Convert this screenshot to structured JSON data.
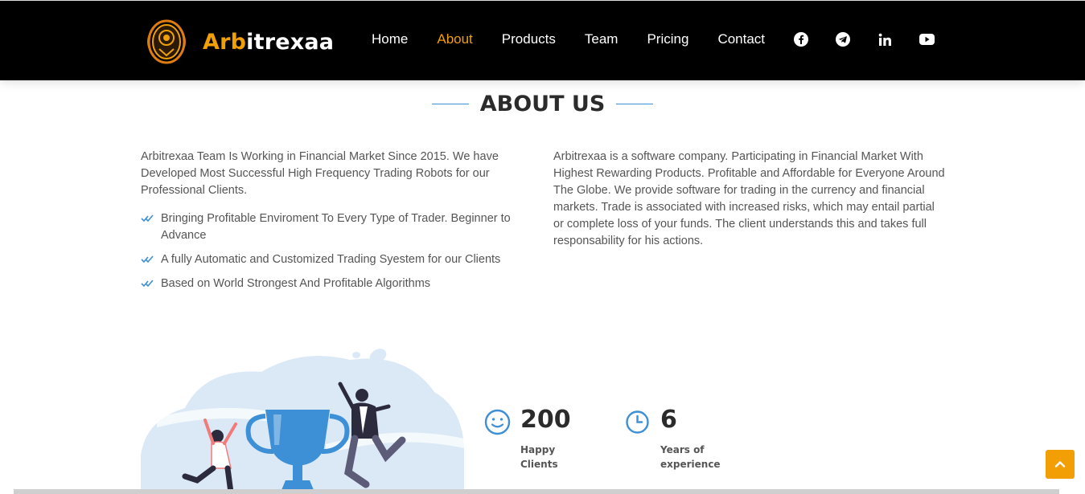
{
  "brand": {
    "name_accent": "Arb",
    "name_rest": "itrexaa",
    "accent_color": "#f29f05"
  },
  "nav": {
    "items": [
      {
        "label": "Home",
        "active": false
      },
      {
        "label": "About",
        "active": true
      },
      {
        "label": "Products",
        "active": false
      },
      {
        "label": "Team",
        "active": false
      },
      {
        "label": "Pricing",
        "active": false
      },
      {
        "label": "Contact",
        "active": false
      }
    ],
    "social_icons": [
      "facebook-icon",
      "telegram-icon",
      "linkedin-icon",
      "youtube-icon"
    ]
  },
  "about": {
    "title": "ABOUT US",
    "intro": "Arbitrexaa Team Is Working in Financial Market Since 2015. We have Developed Most Successful High Frequency Trading Robots for our Professional Clients.",
    "points": [
      "Bringing Profitable Enviroment To Every Type of Trader. Beginner to Advance",
      "A fully Automatic and Customized Trading Syestem for our Clients",
      "Based on World Strongest And Profitable Algorithms"
    ],
    "description": "Arbitrexaa is a software company. Participating in Financial Market With Highest Rewarding Products. Profitable and Affordable for Everyone Around The Globe. We provide software for trading in the currency and financial markets. Trade is associated with increased risks, which may entail partial or complete loss of your funds. The client understands this and takes full responsability for his actions."
  },
  "stats": [
    {
      "icon": "smile-icon",
      "value": "200",
      "label": "Happy Clients"
    },
    {
      "icon": "clock-icon",
      "value": "6",
      "label": "Years of experience"
    }
  ],
  "colors": {
    "header_bg": "#000000",
    "line_blue": "#3d8fd6",
    "icon_blue": "#3d8fd6"
  }
}
